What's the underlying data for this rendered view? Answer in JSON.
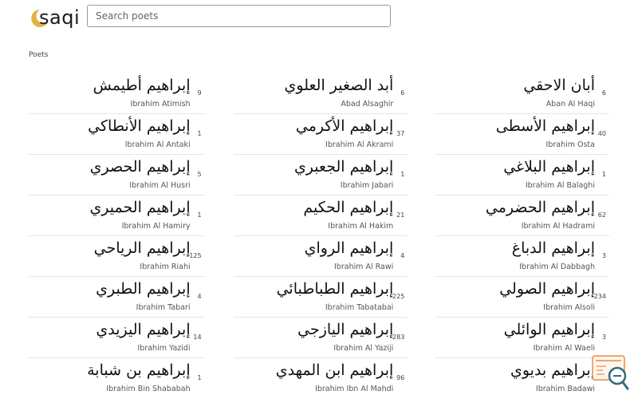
{
  "header": {
    "logo_text": "saqi",
    "search_placeholder": "Search poets"
  },
  "section_label": "Poets",
  "poets": [
    [
      {
        "arabic": "إبراهيم أطيمش",
        "latin": "Ibrahim Atimish",
        "count": "9"
      },
      {
        "arabic": "أبد الصغير العلوي",
        "latin": "Abad Alsaghir",
        "count": "6"
      },
      {
        "arabic": "أبان الاحقي",
        "latin": "Aban Al Haqi",
        "count": "6"
      }
    ],
    [
      {
        "arabic": "إبراهيم الأنطاكي",
        "latin": "Ibrahim Al Antaki",
        "count": "1"
      },
      {
        "arabic": "إبراهيم الأكرمي",
        "latin": "Ibrahim Al Akrami",
        "count": "37"
      },
      {
        "arabic": "إبراهيم الأسطى",
        "latin": "Ibrahim Osta",
        "count": "40"
      }
    ],
    [
      {
        "arabic": "إبراهيم الحصري",
        "latin": "Ibrahim Al Husri",
        "count": "5"
      },
      {
        "arabic": "إبراهيم الجعبري",
        "latin": "Ibrahim Jabari",
        "count": "1"
      },
      {
        "arabic": "إبراهيم البلاغي",
        "latin": "Ibrahim Al Balaghi",
        "count": "1"
      }
    ],
    [
      {
        "arabic": "إبراهيم الحميري",
        "latin": "Ibrahim Al Hamiry",
        "count": "1"
      },
      {
        "arabic": "إبراهيم الحكيم",
        "latin": "Ibrahim Al Hakim",
        "count": "21"
      },
      {
        "arabic": "إبراهيم الحضرمي",
        "latin": "Ibrahim Al Hadrami",
        "count": "62"
      }
    ],
    [
      {
        "arabic": "إبراهيم الرياحي",
        "latin": "Ibrahim Riahi",
        "count": "125"
      },
      {
        "arabic": "إبراهيم الرواي",
        "latin": "Ibrahim Al Rawi",
        "count": "4"
      },
      {
        "arabic": "إبراهيم الدباغ",
        "latin": "Ibrahim Al Dabbagh",
        "count": "3"
      }
    ],
    [
      {
        "arabic": "إبراهيم الطبري",
        "latin": "Ibrahim Tabari",
        "count": "4"
      },
      {
        "arabic": "إبراهيم الطباطبائي",
        "latin": "Ibrahim Tabatabai",
        "count": "225"
      },
      {
        "arabic": "إبراهيم الصولي",
        "latin": "Ibrahim Alsoli",
        "count": "234"
      }
    ],
    [
      {
        "arabic": "إبراهيم اليزيدي",
        "latin": "Ibrahim Yazidi",
        "count": "14"
      },
      {
        "arabic": "إبراهيم اليازجي",
        "latin": "Ibrahim Al Yaziji",
        "count": "283"
      },
      {
        "arabic": "إبراهيم الوائلي",
        "latin": "Ibrahim Al Waeli",
        "count": "3"
      }
    ],
    [
      {
        "arabic": "إبراهيم بن شبابة",
        "latin": "Ibrahim Bin Shababah",
        "count": "1"
      },
      {
        "arabic": "إبراهيم ابن المهدي",
        "latin": "Ibrahim Ibn Al Mahdi",
        "count": "96"
      },
      {
        "arabic": "إبراهيم بديوي",
        "latin": "Ibrahim Badawi",
        "count": "1"
      }
    ]
  ],
  "icons": {
    "logo": "crescent-moon-icon",
    "help_widget": "search-help-icon"
  },
  "colors": {
    "moon": "#e3b341",
    "widget_orange": "#f0883e",
    "widget_teal": "#2e6f7a"
  }
}
